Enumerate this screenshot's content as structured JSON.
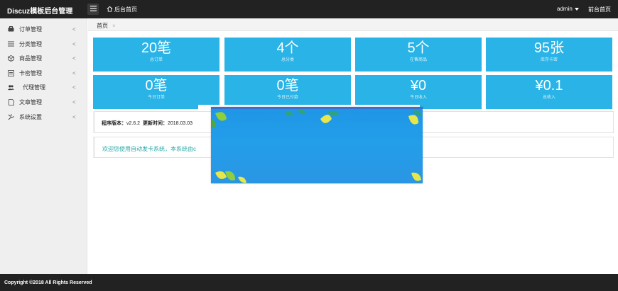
{
  "header": {
    "brand": "Discuz模板后台管理",
    "home_link": "后台首页",
    "user": "admin",
    "front_link": "前台首页"
  },
  "sidebar": {
    "items": [
      {
        "label": "订单管理",
        "icon": "order-icon"
      },
      {
        "label": "分类管理",
        "icon": "category-icon"
      },
      {
        "label": "商品管理",
        "icon": "cube-icon"
      },
      {
        "label": "卡密管理",
        "icon": "card-icon"
      },
      {
        "label": "代理管理",
        "icon": "users-icon"
      },
      {
        "label": "文章管理",
        "icon": "document-icon"
      },
      {
        "label": "系统设置",
        "icon": "wrench-icon"
      }
    ]
  },
  "breadcrumb": {
    "tab": "首页",
    "close": "×"
  },
  "stats": [
    {
      "value": "20笔",
      "label": "总订单"
    },
    {
      "value": "4个",
      "label": "总分类"
    },
    {
      "value": "5个",
      "label": "在售商品"
    },
    {
      "value": "95张",
      "label": "库存卡密"
    },
    {
      "value": "0笔",
      "label": "今日订单"
    },
    {
      "value": "0笔",
      "label": "今日已付款"
    },
    {
      "value": "¥0",
      "label": "今日收入"
    },
    {
      "value": "¥0.1",
      "label": "总收入"
    }
  ],
  "info": {
    "version_label": "程序版本：",
    "version": "v2.6.2",
    "update_label": "更新时间：",
    "update_date": "2018.03.03",
    "welcome": "欢迎您使用自动发卡系统，本系统由c"
  },
  "footer": {
    "copyright": "Copyright ©2018 All Rights Reserved"
  },
  "colors": {
    "tile": "#29b3e6",
    "topbar": "#222222",
    "welcome_text": "#2aa8a8"
  }
}
